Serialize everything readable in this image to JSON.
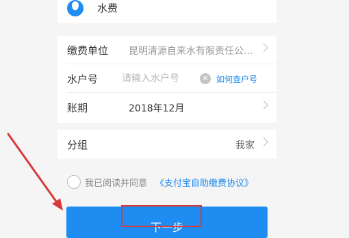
{
  "utility": {
    "name": "水费",
    "icon": "water-drop-icon"
  },
  "form": {
    "provider_label": "缴费单位",
    "provider_value": "昆明清源自来水有限责任公...",
    "account_label": "水户号",
    "account_placeholder": "请输入水户号",
    "account_value": "",
    "lookup_link": "如何查户号",
    "period_label": "账期",
    "period_value": "2018年12月"
  },
  "group": {
    "label": "分组",
    "value": "我家"
  },
  "agreement": {
    "prefix": "我已阅读并同意",
    "link": "《支付宝自助缴费协议》"
  },
  "actions": {
    "next_label": "下一步"
  },
  "colors": {
    "accent": "#1e8cf0",
    "annotation": "#d83a3a",
    "background": "#f5f5f5"
  }
}
